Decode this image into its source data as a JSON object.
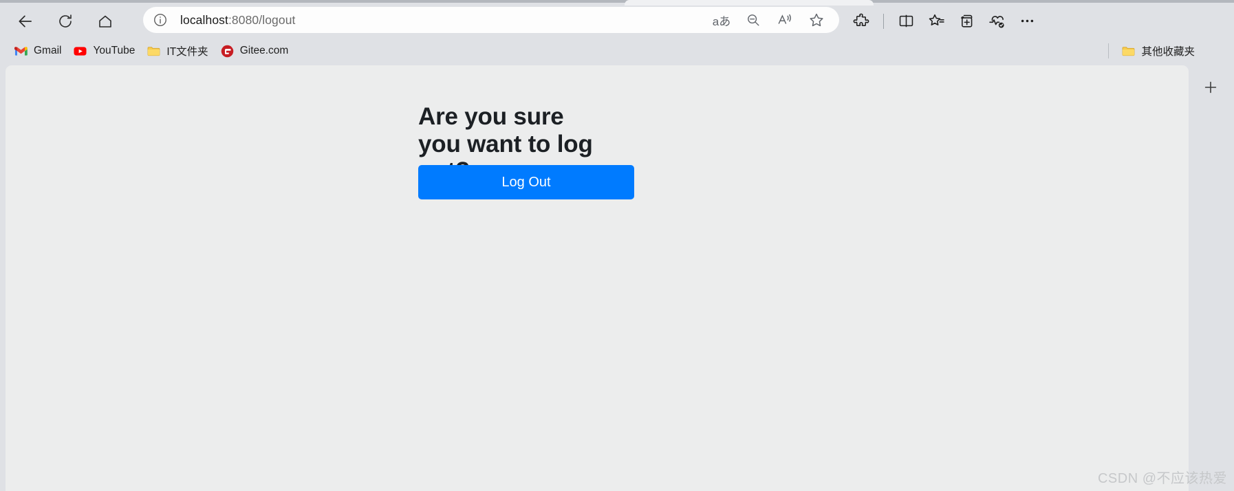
{
  "browser": {
    "nav": {
      "back_label": "Back",
      "reload_label": "Refresh",
      "home_label": "Home"
    },
    "omnibox": {
      "site_info_label": "View site information",
      "url_host": "localhost",
      "url_path": ":8080/logout",
      "full_url": "localhost:8080/logout",
      "actions": [
        {
          "name": "translate-icon",
          "label": "Translate this page",
          "glyph": "aあ"
        },
        {
          "name": "zoom-out-icon",
          "label": "Zoom out"
        },
        {
          "name": "read-aloud-icon",
          "label": "Read this page aloud"
        },
        {
          "name": "favorite-icon",
          "label": "Add this page to favorites"
        }
      ]
    },
    "toolbar_right": [
      {
        "name": "extensions-icon",
        "label": "Extensions"
      },
      {
        "name": "split-screen-icon",
        "label": "Split screen"
      },
      {
        "name": "collections-icon",
        "label": "Collections"
      },
      {
        "name": "add-tab-group-icon",
        "label": "Add tab to new group"
      },
      {
        "name": "browser-essentials-icon",
        "label": "Browser essentials"
      },
      {
        "name": "settings-more-icon",
        "label": "Settings and more"
      }
    ],
    "bookmarks": [
      {
        "name": "gmail",
        "label": "Gmail",
        "icon": "gmail-icon"
      },
      {
        "name": "youtube",
        "label": "YouTube",
        "icon": "youtube-icon"
      },
      {
        "name": "it-folder",
        "label": "IT文件夹",
        "icon": "folder-icon"
      },
      {
        "name": "gitee",
        "label": "Gitee.com",
        "icon": "gitee-icon"
      }
    ],
    "bookmarks_overflow": {
      "label": "其他收藏夹",
      "icon": "folder-icon"
    },
    "right_rail": {
      "add_label": "+"
    }
  },
  "page": {
    "heading": "Are you sure you want to log out?",
    "heading_line1": "Are you sure you",
    "heading_line2": "want to log out?",
    "logout_button_label": "Log Out",
    "accent_color": "#007bff",
    "background_color": "#eceded"
  },
  "watermark": {
    "text": "CSDN @不应该热爱"
  }
}
